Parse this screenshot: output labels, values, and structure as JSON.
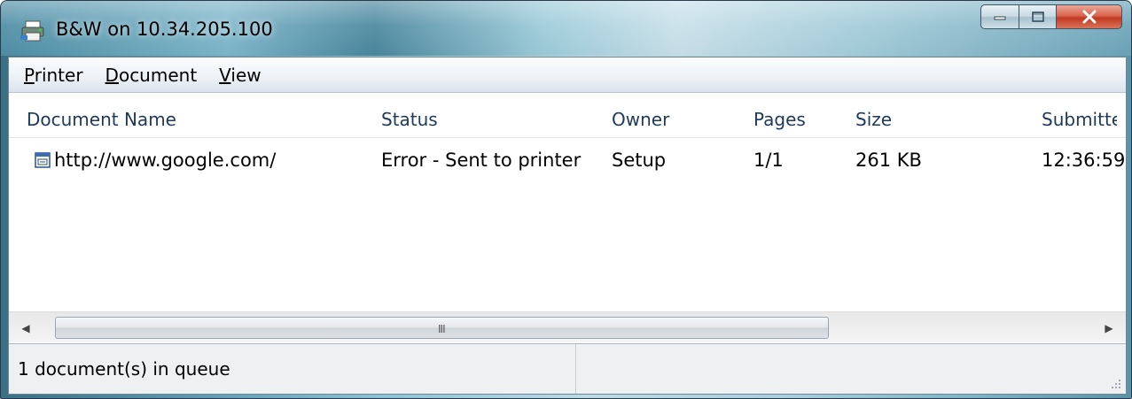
{
  "window": {
    "title": "B&W on 10.34.205.100"
  },
  "menu": {
    "items": [
      {
        "prefix": "P",
        "rest": "rinter"
      },
      {
        "prefix": "D",
        "rest": "ocument"
      },
      {
        "prefix": "V",
        "rest": "iew"
      }
    ]
  },
  "columns": [
    "Document Name",
    "Status",
    "Owner",
    "Pages",
    "Size",
    "Submitte"
  ],
  "rows": [
    {
      "name": "http://www.google.com/",
      "status": "Error - Sent to printer",
      "owner": "Setup",
      "pages": "1/1",
      "size": "261 KB",
      "submitted": "12:36:59"
    }
  ],
  "scrollbar": {
    "left_arrow": "◀",
    "right_arrow": "▶",
    "grip": "III"
  },
  "status": {
    "text": "1 document(s) in queue"
  },
  "icons": {
    "title": "printer-icon",
    "row": "print-job-icon",
    "minimize": "minimize-icon",
    "maximize": "maximize-icon",
    "close": "close-icon"
  },
  "colors": {
    "header_text": "#1e395b",
    "close_button": "#c23a1f"
  }
}
